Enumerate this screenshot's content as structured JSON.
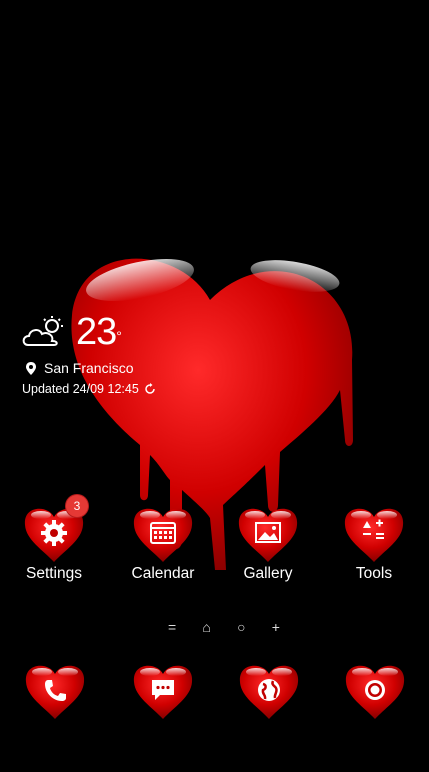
{
  "weather": {
    "temperature": "23",
    "unit": "°",
    "location": "San Francisco",
    "updated": "Updated 24/09 12:45",
    "icon": "partly-cloudy-icon"
  },
  "apps": [
    {
      "label": "Settings",
      "icon": "gear-icon",
      "badge": "3"
    },
    {
      "label": "Calendar",
      "icon": "calendar-icon"
    },
    {
      "label": "Gallery",
      "icon": "image-icon"
    },
    {
      "label": "Tools",
      "icon": "tools-icon"
    }
  ],
  "page_indicator": [
    "=",
    "⌂",
    "○",
    "+"
  ],
  "dock": [
    {
      "icon": "phone-icon"
    },
    {
      "icon": "chat-icon"
    },
    {
      "icon": "globe-icon"
    },
    {
      "icon": "camera-icon"
    }
  ],
  "colors": {
    "background": "#000000",
    "heart": "#d40000",
    "badge": "#e53935"
  }
}
